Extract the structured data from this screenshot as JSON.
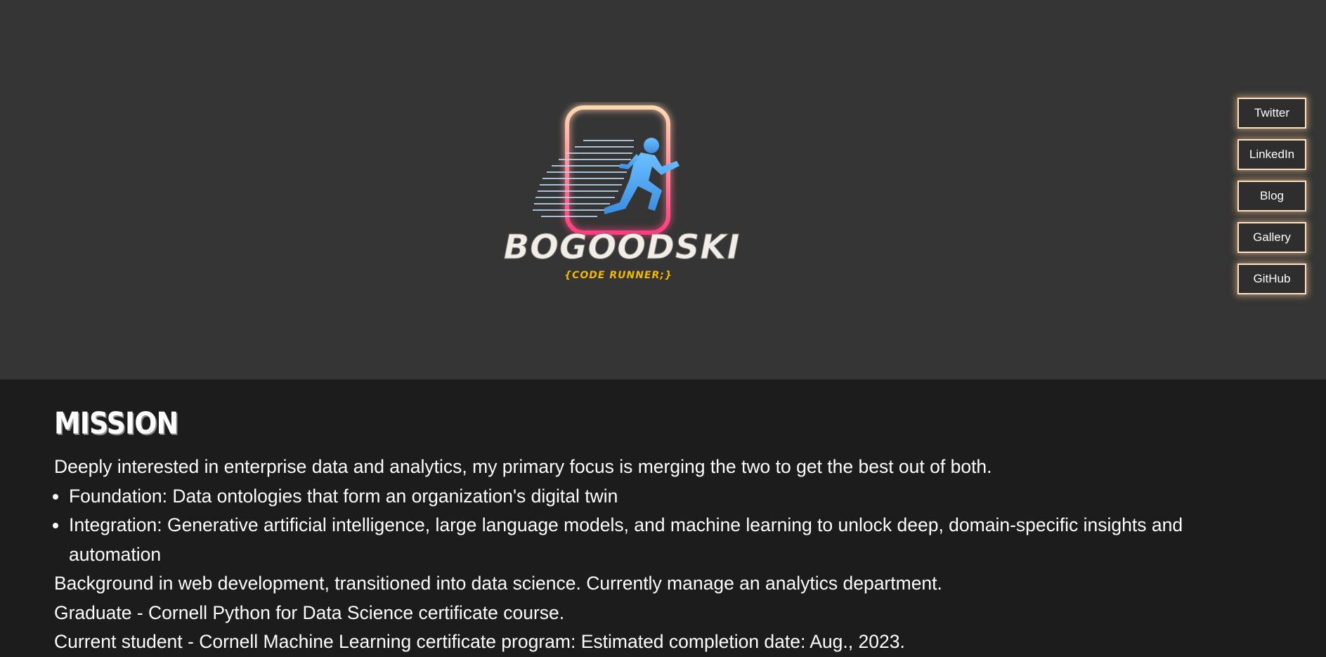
{
  "logo": {
    "title": "BOGOODSKI",
    "tagline": "{CODE RUNNER;}",
    "frame_gradient": [
      "#ffd7b0",
      "#ff3d7f"
    ],
    "runner_color": "#4fa8f0",
    "tagline_color": "#f5b800",
    "icon": "running-person-icon"
  },
  "nav": {
    "twitter": "Twitter",
    "linkedin": "LinkedIn",
    "blog": "Blog",
    "gallery": "Gallery",
    "github": "GitHub"
  },
  "mission": {
    "title": "MISSION",
    "intro": "Deeply interested in enterprise data and analytics, my primary focus is merging the two to get the best out of both.",
    "bullets": [
      "Foundation: Data ontologies that form an organization's digital twin",
      "Integration: Generative artificial intelligence, large language models, and machine learning to unlock deep, domain-specific insights and automation"
    ],
    "background": "Background in web development, transitioned into data science. Currently manage an analytics department.",
    "graduate": "Graduate - Cornell Python for Data Science certificate course.",
    "current": "Current student - Cornell Machine Learning certificate program: Estimated completion date: Aug., 2023."
  },
  "colors": {
    "hero_bg": "#353535",
    "content_bg": "#1c1c1c",
    "button_border": "#ffe1c2"
  }
}
